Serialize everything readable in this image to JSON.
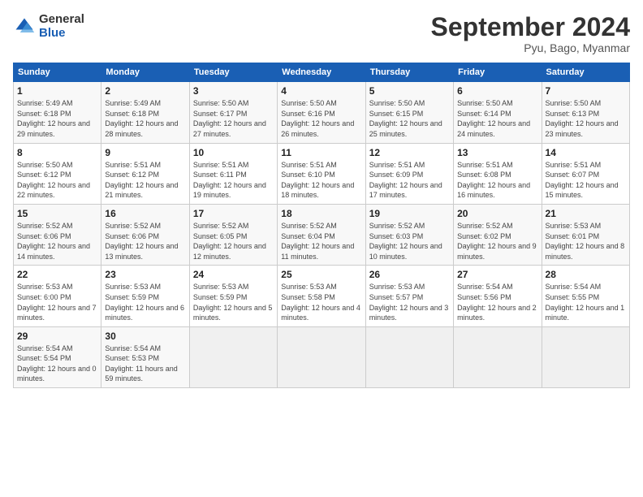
{
  "logo": {
    "general": "General",
    "blue": "Blue"
  },
  "header": {
    "title": "September 2024",
    "subtitle": "Pyu, Bago, Myanmar"
  },
  "weekdays": [
    "Sunday",
    "Monday",
    "Tuesday",
    "Wednesday",
    "Thursday",
    "Friday",
    "Saturday"
  ],
  "weeks": [
    [
      {
        "day": "1",
        "detail": "Sunrise: 5:49 AM\nSunset: 6:18 PM\nDaylight: 12 hours and 29 minutes."
      },
      {
        "day": "2",
        "detail": "Sunrise: 5:49 AM\nSunset: 6:18 PM\nDaylight: 12 hours and 28 minutes."
      },
      {
        "day": "3",
        "detail": "Sunrise: 5:50 AM\nSunset: 6:17 PM\nDaylight: 12 hours and 27 minutes."
      },
      {
        "day": "4",
        "detail": "Sunrise: 5:50 AM\nSunset: 6:16 PM\nDaylight: 12 hours and 26 minutes."
      },
      {
        "day": "5",
        "detail": "Sunrise: 5:50 AM\nSunset: 6:15 PM\nDaylight: 12 hours and 25 minutes."
      },
      {
        "day": "6",
        "detail": "Sunrise: 5:50 AM\nSunset: 6:14 PM\nDaylight: 12 hours and 24 minutes."
      },
      {
        "day": "7",
        "detail": "Sunrise: 5:50 AM\nSunset: 6:13 PM\nDaylight: 12 hours and 23 minutes."
      }
    ],
    [
      {
        "day": "8",
        "detail": "Sunrise: 5:50 AM\nSunset: 6:12 PM\nDaylight: 12 hours and 22 minutes."
      },
      {
        "day": "9",
        "detail": "Sunrise: 5:51 AM\nSunset: 6:12 PM\nDaylight: 12 hours and 21 minutes."
      },
      {
        "day": "10",
        "detail": "Sunrise: 5:51 AM\nSunset: 6:11 PM\nDaylight: 12 hours and 19 minutes."
      },
      {
        "day": "11",
        "detail": "Sunrise: 5:51 AM\nSunset: 6:10 PM\nDaylight: 12 hours and 18 minutes."
      },
      {
        "day": "12",
        "detail": "Sunrise: 5:51 AM\nSunset: 6:09 PM\nDaylight: 12 hours and 17 minutes."
      },
      {
        "day": "13",
        "detail": "Sunrise: 5:51 AM\nSunset: 6:08 PM\nDaylight: 12 hours and 16 minutes."
      },
      {
        "day": "14",
        "detail": "Sunrise: 5:51 AM\nSunset: 6:07 PM\nDaylight: 12 hours and 15 minutes."
      }
    ],
    [
      {
        "day": "15",
        "detail": "Sunrise: 5:52 AM\nSunset: 6:06 PM\nDaylight: 12 hours and 14 minutes."
      },
      {
        "day": "16",
        "detail": "Sunrise: 5:52 AM\nSunset: 6:06 PM\nDaylight: 12 hours and 13 minutes."
      },
      {
        "day": "17",
        "detail": "Sunrise: 5:52 AM\nSunset: 6:05 PM\nDaylight: 12 hours and 12 minutes."
      },
      {
        "day": "18",
        "detail": "Sunrise: 5:52 AM\nSunset: 6:04 PM\nDaylight: 12 hours and 11 minutes."
      },
      {
        "day": "19",
        "detail": "Sunrise: 5:52 AM\nSunset: 6:03 PM\nDaylight: 12 hours and 10 minutes."
      },
      {
        "day": "20",
        "detail": "Sunrise: 5:52 AM\nSunset: 6:02 PM\nDaylight: 12 hours and 9 minutes."
      },
      {
        "day": "21",
        "detail": "Sunrise: 5:53 AM\nSunset: 6:01 PM\nDaylight: 12 hours and 8 minutes."
      }
    ],
    [
      {
        "day": "22",
        "detail": "Sunrise: 5:53 AM\nSunset: 6:00 PM\nDaylight: 12 hours and 7 minutes."
      },
      {
        "day": "23",
        "detail": "Sunrise: 5:53 AM\nSunset: 5:59 PM\nDaylight: 12 hours and 6 minutes."
      },
      {
        "day": "24",
        "detail": "Sunrise: 5:53 AM\nSunset: 5:59 PM\nDaylight: 12 hours and 5 minutes."
      },
      {
        "day": "25",
        "detail": "Sunrise: 5:53 AM\nSunset: 5:58 PM\nDaylight: 12 hours and 4 minutes."
      },
      {
        "day": "26",
        "detail": "Sunrise: 5:53 AM\nSunset: 5:57 PM\nDaylight: 12 hours and 3 minutes."
      },
      {
        "day": "27",
        "detail": "Sunrise: 5:54 AM\nSunset: 5:56 PM\nDaylight: 12 hours and 2 minutes."
      },
      {
        "day": "28",
        "detail": "Sunrise: 5:54 AM\nSunset: 5:55 PM\nDaylight: 12 hours and 1 minute."
      }
    ],
    [
      {
        "day": "29",
        "detail": "Sunrise: 5:54 AM\nSunset: 5:54 PM\nDaylight: 12 hours and 0 minutes."
      },
      {
        "day": "30",
        "detail": "Sunrise: 5:54 AM\nSunset: 5:53 PM\nDaylight: 11 hours and 59 minutes."
      },
      null,
      null,
      null,
      null,
      null
    ]
  ]
}
